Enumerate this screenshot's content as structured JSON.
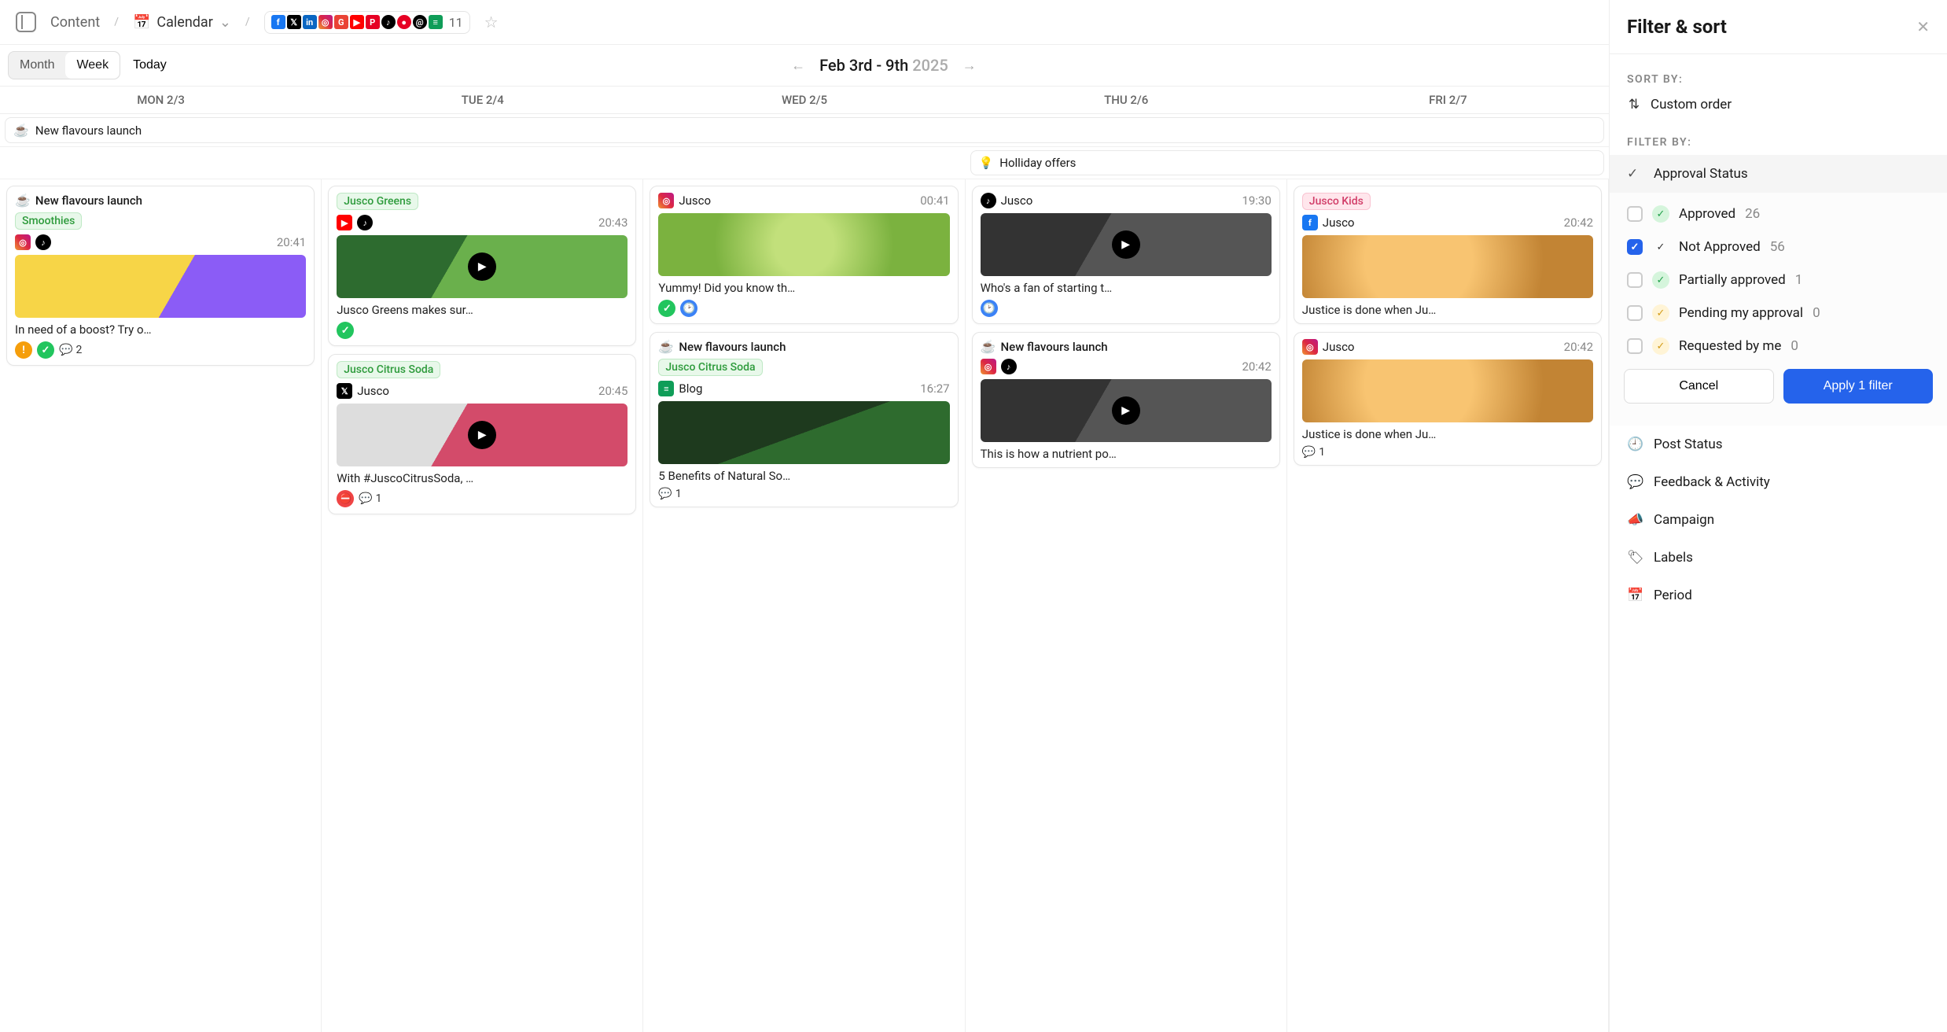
{
  "topbar": {
    "crumb_content": "Content",
    "crumb_calendar": "Calendar",
    "network_count": "11"
  },
  "subbar": {
    "month": "Month",
    "week": "Week",
    "today": "Today",
    "range_main": "Feb 3rd - 9th",
    "range_year": "2025"
  },
  "days": [
    "MON 2/3",
    "TUE 2/4",
    "WED 2/5",
    "THU 2/6",
    "FRI 2/7"
  ],
  "banners": {
    "flavours": "New flavours launch",
    "holiday": "Holliday offers"
  },
  "cards": {
    "mon1": {
      "campaign": "New flavours launch",
      "label": "Smoothies",
      "time": "20:41",
      "caption": "In need of a boost? Try o…",
      "comments": "2"
    },
    "tue1": {
      "label": "Jusco Greens",
      "time": "20:43",
      "caption": "Jusco Greens makes sur…"
    },
    "tue2": {
      "label": "Jusco Citrus Soda",
      "account": "Jusco",
      "time": "20:45",
      "caption": "With #JuscoCitrusSoda, …",
      "comments": "1"
    },
    "wed1": {
      "account": "Jusco",
      "time": "00:41",
      "caption": "Yummy! Did you know th…"
    },
    "wed2": {
      "campaign": "New flavours launch",
      "label": "Jusco Citrus Soda",
      "account": "Blog",
      "time": "16:27",
      "caption": "5 Benefits of Natural So…",
      "comments": "1"
    },
    "thu1": {
      "account": "Jusco",
      "time": "19:30",
      "caption": "Who's a fan of starting t…"
    },
    "thu2": {
      "campaign": "New flavours launch",
      "time": "20:42",
      "caption": "This is how a nutrient po…"
    },
    "fri1": {
      "label": "Jusco Kids",
      "account": "Jusco",
      "time": "20:42",
      "caption": "Justice is done when Ju…"
    },
    "fri2": {
      "account": "Jusco",
      "time": "20:42",
      "caption": "Justice is done when Ju…",
      "comments": "1"
    }
  },
  "panel": {
    "title": "Filter & sort",
    "sort_label": "SORT BY:",
    "sort_value": "Custom order",
    "filter_label": "FILTER BY:",
    "approval_status": "Approval Status",
    "options": {
      "approved": {
        "label": "Approved",
        "count": "26"
      },
      "not_approved": {
        "label": "Not Approved",
        "count": "56"
      },
      "partial": {
        "label": "Partially approved",
        "count": "1"
      },
      "pending": {
        "label": "Pending my approval",
        "count": "0"
      },
      "requested": {
        "label": "Requested by me",
        "count": "0"
      }
    },
    "cancel": "Cancel",
    "apply": "Apply 1 filter",
    "groups": {
      "post_status": "Post Status",
      "feedback": "Feedback & Activity",
      "campaign": "Campaign",
      "labels": "Labels",
      "period": "Period"
    }
  }
}
